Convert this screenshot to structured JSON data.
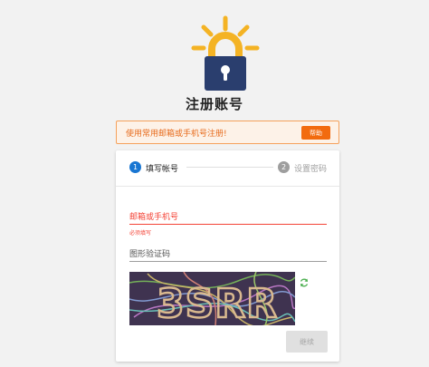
{
  "header": {
    "title": "注册账号",
    "logo_icon": "padlock-sun-logo"
  },
  "notice": {
    "text": "使用常用邮箱或手机号注册!",
    "help_label": "帮助",
    "text_color": "#e76b1c",
    "button_color": "#f26b0f"
  },
  "stepper": {
    "steps": [
      {
        "number": "1",
        "label": "填写帐号",
        "active": true
      },
      {
        "number": "2",
        "label": "设置密码",
        "active": false
      }
    ],
    "active_color": "#1976d2"
  },
  "form": {
    "email_label": "邮箱或手机号",
    "email_helper": "必须填写",
    "captcha_label": "图形验证码",
    "captcha_text": "3SRR",
    "refresh_icon": "refresh-icon",
    "continue_label": "继续",
    "error_color": "#f44336"
  }
}
